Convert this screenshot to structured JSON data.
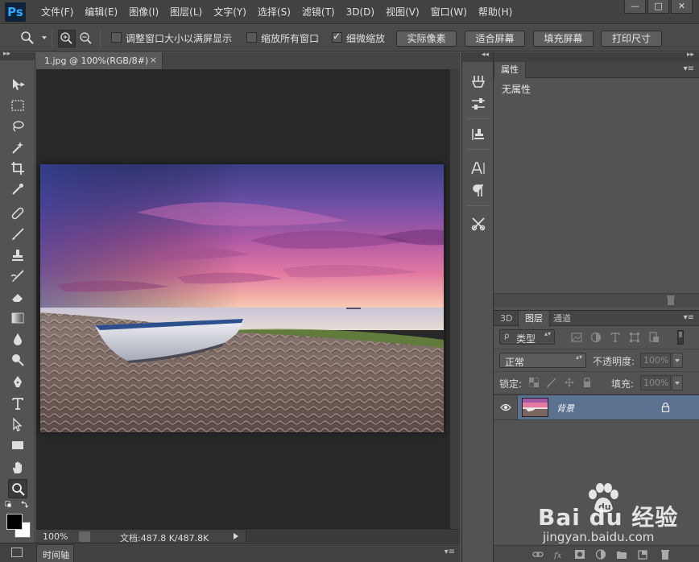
{
  "app": {
    "logo": "Ps"
  },
  "menu": [
    "文件(F)",
    "编辑(E)",
    "图像(I)",
    "图层(L)",
    "文字(Y)",
    "选择(S)",
    "滤镜(T)",
    "3D(D)",
    "视图(V)",
    "窗口(W)",
    "帮助(H)"
  ],
  "window_controls": {
    "minimize": "—",
    "maximize": "□",
    "close": "✕"
  },
  "options": {
    "resize_windows_label": "调整窗口大小以满屏显示",
    "resize_windows_checked": false,
    "zoom_all_label": "缩放所有窗口",
    "zoom_all_checked": false,
    "scrubby_label": "细微缩放",
    "scrubby_checked": true,
    "actual_pixels": "实际像素",
    "fit_screen": "适合屏幕",
    "fill_screen": "填充屏幕",
    "print_size": "打印尺寸"
  },
  "tools_panel": {
    "collapse": "▸▸",
    "icons": [
      "move-tool",
      "marquee-tool",
      "lasso-tool",
      "magic-wand-tool",
      "crop-tool",
      "eyedropper-tool",
      "healing-brush-tool",
      "brush-tool",
      "clone-stamp-tool",
      "history-brush-tool",
      "eraser-tool",
      "gradient-tool",
      "blur-tool",
      "dodge-tool",
      "pen-tool",
      "type-tool",
      "path-selection-tool",
      "rectangle-tool",
      "hand-tool",
      "zoom-tool"
    ]
  },
  "document": {
    "tab_title": "1.jpg @ 100%(RGB/8#)",
    "tab_close": "×",
    "zoom": "100%",
    "doc_size": "文档:487.8 K/487.8K"
  },
  "timeline": {
    "label": "时间轴",
    "menu": "▾≡"
  },
  "iconstrip": {
    "collapse": "◂◂"
  },
  "properties": {
    "collapse": "▸▸",
    "tab": "属性",
    "menu": "▾≡",
    "empty_text": "无属性"
  },
  "layers": {
    "tabs": [
      "3D",
      "图层",
      "通道"
    ],
    "menu": "▾≡",
    "filter_label": "类型",
    "filter_search": "ρ",
    "blend_mode": "正常",
    "opacity_label": "不透明度:",
    "opacity_value": "100%",
    "lock_label": "锁定:",
    "fill_label": "填充:",
    "fill_value": "100%",
    "layer_name": "背景",
    "updown": "▴▾"
  },
  "watermark": {
    "brand": "Bai du 经验",
    "url": "jingyan.baidu.com"
  },
  "colors": {
    "ui_bg": "#535353",
    "canvas_bg": "#282828",
    "selected_layer": "#5a7190",
    "ps_blue": "#31a8ff"
  }
}
